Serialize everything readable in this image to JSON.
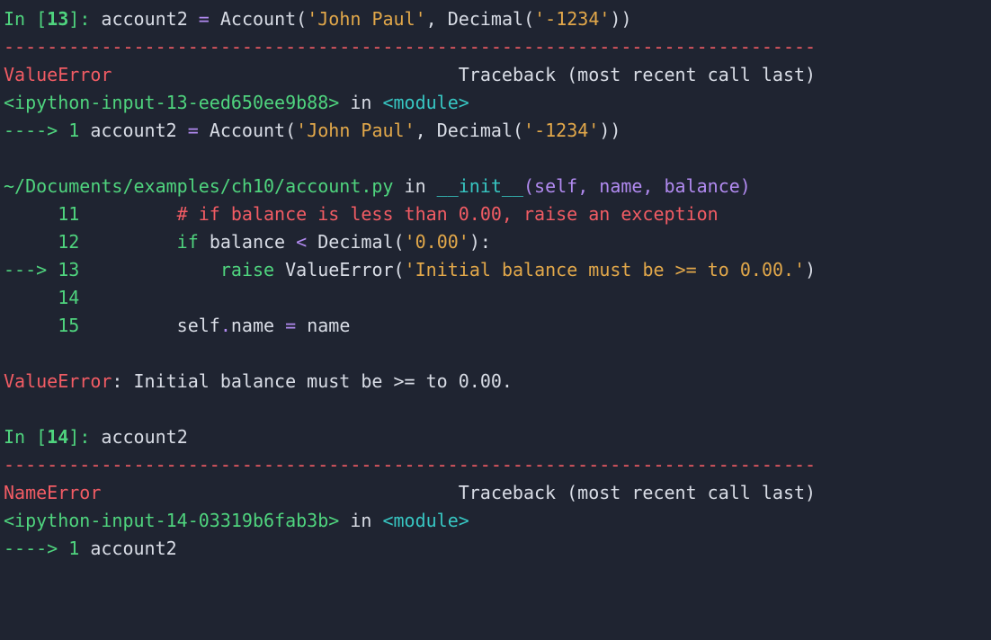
{
  "cell13": {
    "prompt_in": "In ",
    "prompt_lbr": "[",
    "prompt_num": "13",
    "prompt_rbr": "]",
    "prompt_colon": ": ",
    "code_lhs": "account2 ",
    "code_eq": "=",
    "code_sp1": " ",
    "code_fn1": "Account",
    "code_lp1": "(",
    "code_str1": "'John Paul'",
    "code_comma": ", ",
    "code_fn2": "Decimal",
    "code_lp2": "(",
    "code_str2": "'-1234'",
    "code_rp2": ")",
    "code_rp1": ")"
  },
  "dash_line": "---------------------------------------------------------------------------",
  "err1": {
    "name": "ValueError",
    "tb_label": "                                Traceback (most recent call last)",
    "src_id": "<ipython-input-13-eed650ee9b88>",
    "in_word": " in ",
    "in_module": "<module>",
    "arrow1": "----> ",
    "ln1": "1",
    "ln1_sp": " ",
    "rp_lhs": "account2 ",
    "rp_eq": "=",
    "rp_sp": " ",
    "rp_fn1": "Account",
    "rp_lp1": "(",
    "rp_str1": "'John Paul'",
    "rp_comma": ", ",
    "rp_fn2": "Decimal",
    "rp_lp2": "(",
    "rp_str2": "'-1234'",
    "rp_rp2": ")",
    "rp_rp1": ")",
    "frame2_path": "~/Documents/examples/ch10/account.py",
    "frame2_inword": " in ",
    "frame2_fn": "__init__",
    "frame2_args": "(self, name, balance)",
    "row11_no": "     11",
    "row11_pad": "         ",
    "row11_cmt": "# if balance is less than 0.00, raise an exception",
    "row12_no": "     12",
    "row12_pad": "         ",
    "row12_ifkw": "if",
    "row12_sp1": " ",
    "row12_var1": "balance ",
    "row12_lt": "<",
    "row12_sp2": " ",
    "row12_fn": "Decimal",
    "row12_lp": "(",
    "row12_str": "'0.00'",
    "row12_rp": ")",
    "row12_colon": ":",
    "row13_arrow": "---> ",
    "row13_no": "13",
    "row13_pad": "             ",
    "row13_kw": "raise",
    "row13_sp": " ",
    "row13_cls": "ValueError",
    "row13_lp": "(",
    "row13_str": "'Initial balance must be >= to 0.00.'",
    "row13_rp": ")",
    "row14_no": "     14",
    "row15_no": "     15",
    "row15_pad": "         ",
    "row15_self": "self",
    "row15_dot": ".",
    "row15_attr": "name ",
    "row15_eq": "=",
    "row15_sp": " ",
    "row15_rhs": "name",
    "final_name": "ValueError",
    "final_msg": ": Initial balance must be >= to 0.00."
  },
  "cell14": {
    "prompt_in": "In ",
    "prompt_lbr": "[",
    "prompt_num": "14",
    "prompt_rbr": "]",
    "prompt_colon": ": ",
    "code": "account2"
  },
  "err2": {
    "name": "NameError",
    "tb_label": "                                 Traceback (most recent call last)",
    "src_id": "<ipython-input-14-03319b6fab3b>",
    "in_word": " in ",
    "in_module": "<module>",
    "arrow1": "----> ",
    "ln1": "1",
    "ln1_sp": " ",
    "code": "account2"
  }
}
